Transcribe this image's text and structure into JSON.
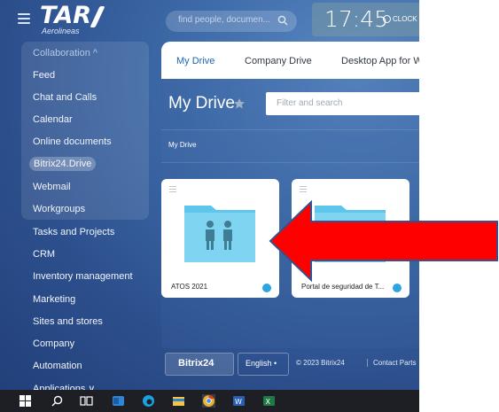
{
  "logo": {
    "main": "TAR",
    "sub": "Aerolineas"
  },
  "search": {
    "placeholder": "find people, documen..."
  },
  "clock": {
    "time": "17:45",
    "label": "CLOCK I"
  },
  "sidebar": {
    "items": [
      {
        "label": "Collaboration ^",
        "kind": "section"
      },
      {
        "label": "Feed"
      },
      {
        "label": "Chat and Calls"
      },
      {
        "label": "Calendar"
      },
      {
        "label": "Online documents"
      },
      {
        "label": "Bitrix24.Drive",
        "active": true
      },
      {
        "label": "Webmail"
      },
      {
        "label": "Workgroups"
      },
      {
        "label": "Tasks and Projects"
      },
      {
        "label": "CRM"
      },
      {
        "label": "Inventory management"
      },
      {
        "label": "Marketing"
      },
      {
        "label": "Sites and stores"
      },
      {
        "label": "Company"
      },
      {
        "label": "Automation"
      },
      {
        "label": "Applications ∨"
      }
    ]
  },
  "tabs": [
    "My Drive",
    "Company Drive",
    "Desktop App for W"
  ],
  "page": {
    "title": "My Drive",
    "filter_placeholder": "Filter and search",
    "breadcrumb": "My Drive"
  },
  "files": [
    {
      "name": "ATOS 2021"
    },
    {
      "name": "Portal de seguridad de T..."
    }
  ],
  "footer": {
    "bitrix": "Bitrix24",
    "language": "English •",
    "copyright": "© 2023 Bitrix24",
    "contact": "Contact Parts"
  },
  "colors": {
    "accent": "#2067b0",
    "folder": "#7dd3ef",
    "arrow": "#ff0000"
  }
}
